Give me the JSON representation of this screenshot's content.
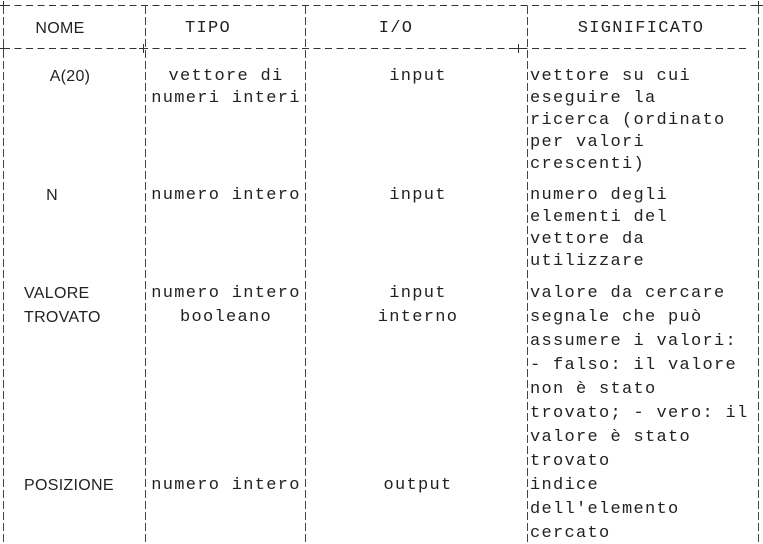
{
  "header": {
    "nome": "NOME",
    "tipo": "TIPO",
    "io": "I/O",
    "significato": "SIGNIFICATO"
  },
  "rows": [
    {
      "nome": "A(20)",
      "tipo": [
        "vettore di",
        "numeri interi"
      ],
      "io": [
        "input"
      ],
      "significato": [
        "vettore su cui",
        "eseguire la",
        "ricerca (ordinato",
        "per valori",
        "crescenti)"
      ]
    },
    {
      "nome": "N",
      "tipo": [
        "numero intero"
      ],
      "io": [
        "input"
      ],
      "significato": [
        "numero degli",
        "elementi del",
        "vettore da",
        "utilizzare"
      ]
    },
    {
      "nome": "VALORE",
      "tipo": [
        "numero intero"
      ],
      "io": [
        "input"
      ],
      "significato": [
        "valore da cercare"
      ]
    },
    {
      "nome": "TROVATO",
      "tipo": [
        "booleano"
      ],
      "io": [
        "interno"
      ],
      "significato": [
        "segnale che può",
        "assumere i valori:",
        "- falso: il valore",
        "non è stato",
        "trovato; - vero: il",
        "valore è stato",
        "trovato"
      ]
    },
    {
      "nome": "POSIZIONE",
      "tipo": [
        "numero intero"
      ],
      "io": [
        "output"
      ],
      "significato": [
        "indice",
        "dell'elemento",
        "cercato"
      ]
    }
  ]
}
